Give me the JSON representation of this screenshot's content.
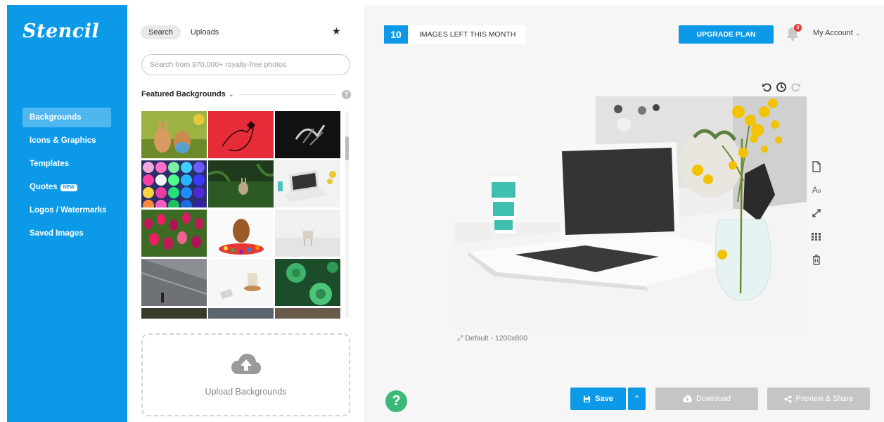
{
  "sidebar": {
    "logo": "Stencil",
    "items": [
      {
        "label": "Backgrounds",
        "active": true
      },
      {
        "label": "Icons & Graphics"
      },
      {
        "label": "Templates"
      },
      {
        "label": "Quotes",
        "badge": "NEW"
      },
      {
        "label": "Logos / Watermarks"
      },
      {
        "label": "Saved Images"
      }
    ],
    "color": "#0c9ae8"
  },
  "library": {
    "tabs": [
      {
        "label": "Search",
        "active": true
      },
      {
        "label": "Uploads"
      }
    ],
    "search_placeholder": "Search from 970,000+ royalty-free photos",
    "section_label": "Featured Backgrounds",
    "upload_label": "Upload Backgrounds"
  },
  "header": {
    "images_left": "10",
    "images_left_label": "IMAGES LEFT THIS MONTH",
    "upgrade_label": "UPGRADE PLAN",
    "notification_count": "3",
    "account_label": "My Account"
  },
  "canvas": {
    "size_label": "Default - 1200x800"
  },
  "actions": {
    "save": "Save",
    "download": "Download",
    "preview_share": "Preview & Share"
  }
}
